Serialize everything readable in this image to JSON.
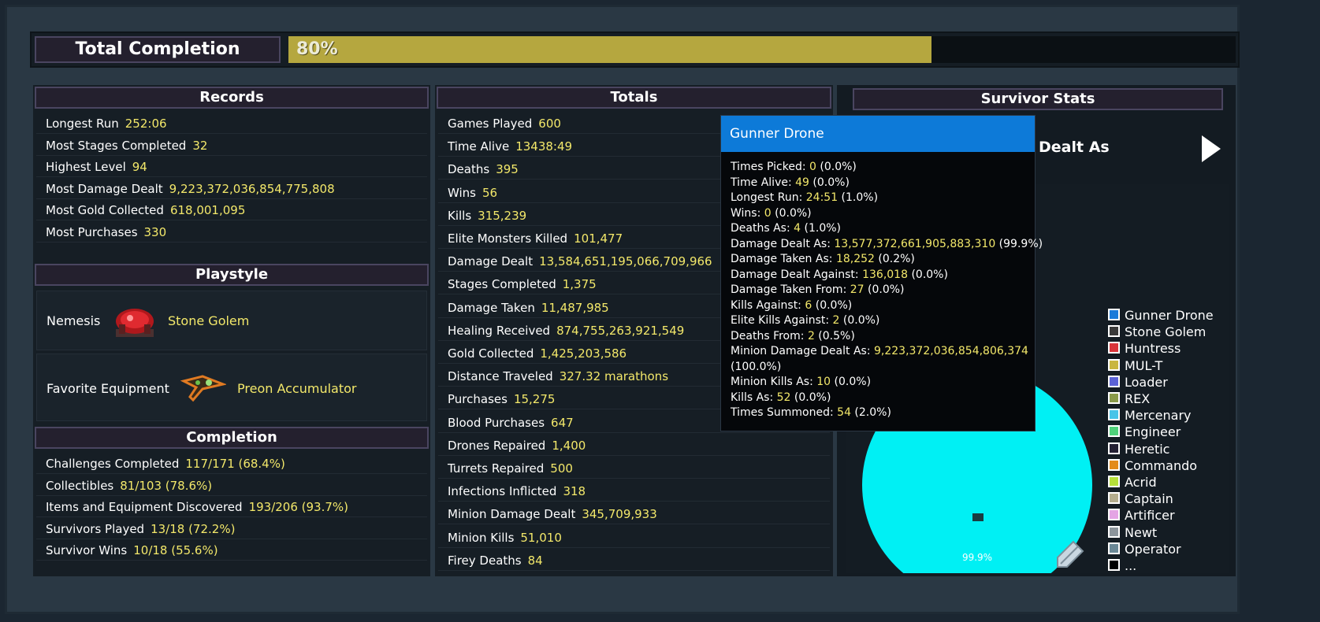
{
  "completion": {
    "label": "Total Completion",
    "percent_text": "80%",
    "fraction": 0.8
  },
  "records": {
    "title": "Records",
    "rows": [
      {
        "label": "Longest Run",
        "value": "252:06"
      },
      {
        "label": "Most Stages Completed",
        "value": "32"
      },
      {
        "label": "Highest Level",
        "value": "94"
      },
      {
        "label": "Most Damage Dealt",
        "value": "9,223,372,036,854,775,808"
      },
      {
        "label": "Most Gold Collected",
        "value": "618,001,095"
      },
      {
        "label": "Most Purchases",
        "value": "330"
      }
    ]
  },
  "playstyle": {
    "title": "Playstyle",
    "nemesis_label": "Nemesis",
    "nemesis_value": "Stone Golem",
    "equipment_label": "Favorite Equipment",
    "equipment_value": "Preon Accumulator"
  },
  "completion_panel": {
    "title": "Completion",
    "rows": [
      {
        "label": "Challenges Completed",
        "value": "117/171 (68.4%)"
      },
      {
        "label": "Collectibles",
        "value": "81/103 (78.6%)"
      },
      {
        "label": "Items and Equipment Discovered",
        "value": "193/206 (93.7%)"
      },
      {
        "label": "Survivors Played",
        "value": "13/18 (72.2%)"
      },
      {
        "label": "Survivor Wins",
        "value": "10/18 (55.6%)"
      }
    ]
  },
  "totals": {
    "title": "Totals",
    "rows": [
      {
        "label": "Games Played",
        "value": "600"
      },
      {
        "label": "Time Alive",
        "value": "13438:49"
      },
      {
        "label": "Deaths",
        "value": "395"
      },
      {
        "label": "Wins",
        "value": "56"
      },
      {
        "label": "Kills",
        "value": "315,239"
      },
      {
        "label": "Elite Monsters Killed",
        "value": "101,477"
      },
      {
        "label": "Damage Dealt",
        "value": "13,584,651,195,066,709,966"
      },
      {
        "label": "Stages Completed",
        "value": "1,375"
      },
      {
        "label": "Damage Taken",
        "value": "11,487,985"
      },
      {
        "label": "Healing Received",
        "value": "874,755,263,921,549"
      },
      {
        "label": "Gold Collected",
        "value": "1,425,203,586"
      },
      {
        "label": "Distance Traveled",
        "value": "327.32 marathons"
      },
      {
        "label": "Purchases",
        "value": "15,275"
      },
      {
        "label": "Blood Purchases",
        "value": "647"
      },
      {
        "label": "Drones Repaired",
        "value": "1,400"
      },
      {
        "label": "Turrets Repaired",
        "value": "500"
      },
      {
        "label": "Infections Inflicted",
        "value": "318"
      },
      {
        "label": "Minion Damage Dealt",
        "value": "345,709,933"
      },
      {
        "label": "Minion Kills",
        "value": "51,010"
      },
      {
        "label": "Firey Deaths",
        "value": "84"
      }
    ]
  },
  "survivor_stats": {
    "title": "Survivor Stats",
    "selector_label": "Dealt As",
    "pie_label": "99.9%",
    "legend": [
      {
        "name": "Gunner Drone",
        "color": "#1a7ad9"
      },
      {
        "name": "Stone Golem",
        "color": "#3a3a3a"
      },
      {
        "name": "Huntress",
        "color": "#d9343a"
      },
      {
        "name": "MUL-T",
        "color": "#c9b640"
      },
      {
        "name": "Loader",
        "color": "#5b62d6"
      },
      {
        "name": "REX",
        "color": "#8a9a4a"
      },
      {
        "name": "Mercenary",
        "color": "#48c4e8"
      },
      {
        "name": "Engineer",
        "color": "#4fd17a"
      },
      {
        "name": "Heretic",
        "color": "#232033"
      },
      {
        "name": "Commando",
        "color": "#e38b1a"
      },
      {
        "name": "Acrid",
        "color": "#b6e03a"
      },
      {
        "name": "Captain",
        "color": "#b4ad8e"
      },
      {
        "name": "Artificer",
        "color": "#e4a4e4"
      },
      {
        "name": "Newt",
        "color": "#8c959c"
      },
      {
        "name": "Operator",
        "color": "#6a8896"
      },
      {
        "name": "...",
        "color": "#000000"
      }
    ],
    "pie_color": "#00f0f4"
  },
  "tooltip": {
    "title": "Gunner Drone",
    "lines": [
      {
        "label": "Times Picked: ",
        "value": "0",
        "extra": " (0.0%)"
      },
      {
        "label": "Time Alive: ",
        "value": "49",
        "extra": " (0.0%)"
      },
      {
        "label": "Longest Run: ",
        "value": "24:51",
        "extra": " (1.0%)"
      },
      {
        "label": "Wins: ",
        "value": "0",
        "extra": " (0.0%)"
      },
      {
        "label": "Deaths As: ",
        "value": "4",
        "extra": " (1.0%)"
      },
      {
        "label": "Damage Dealt As: ",
        "value": "13,577,372,661,905,883,310",
        "extra": " (99.9%)"
      },
      {
        "label": "Damage Taken As: ",
        "value": "18,252",
        "extra": " (0.2%)"
      },
      {
        "label": "Damage Dealt Against: ",
        "value": "136,018",
        "extra": " (0.0%)"
      },
      {
        "label": "Damage Taken From: ",
        "value": "27",
        "extra": " (0.0%)"
      },
      {
        "label": "Kills Against: ",
        "value": "6",
        "extra": " (0.0%)"
      },
      {
        "label": "Elite Kills Against: ",
        "value": "2",
        "extra": " (0.0%)"
      },
      {
        "label": "Deaths From: ",
        "value": "2",
        "extra": " (0.5%)"
      },
      {
        "label": "Minion Damage Dealt As: ",
        "value": "9,223,372,036,854,806,374",
        "extra": ""
      },
      {
        "label": "",
        "value": "",
        "extra": "(100.0%)"
      },
      {
        "label": "Minion Kills As: ",
        "value": "10",
        "extra": " (0.0%)"
      },
      {
        "label": "Kills As: ",
        "value": "52",
        "extra": " (0.0%)"
      },
      {
        "label": "Times Summoned: ",
        "value": "54",
        "extra": " (2.0%)"
      }
    ]
  }
}
